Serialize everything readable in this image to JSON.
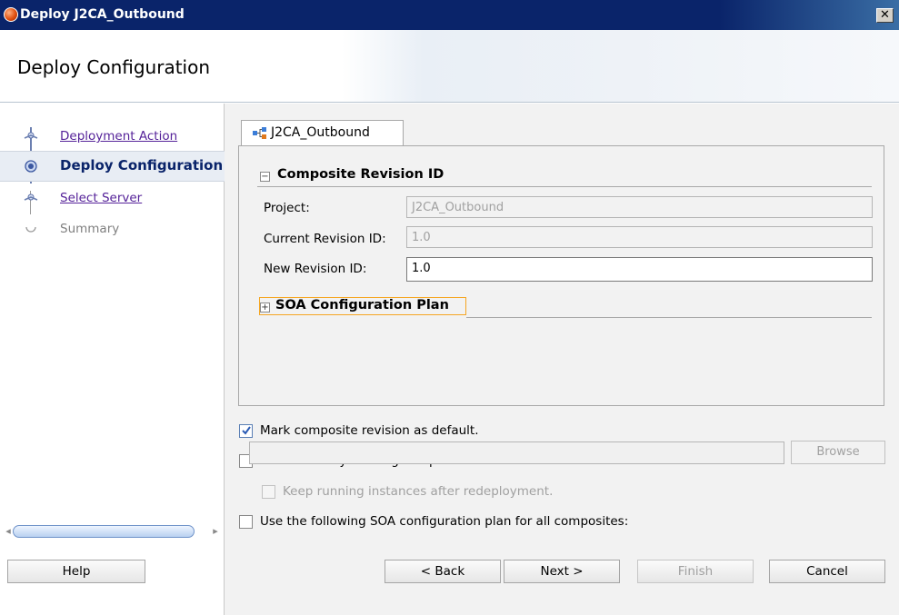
{
  "window": {
    "title": "Deploy J2CA_Outbound",
    "close_symbol": "✕"
  },
  "header": {
    "title": "Deploy Configuration"
  },
  "steps": [
    {
      "label": "Deployment Action",
      "state": "done"
    },
    {
      "label": "Deploy Configuration",
      "state": "current"
    },
    {
      "label": "Select Server",
      "state": "done"
    },
    {
      "label": "Summary",
      "state": "todo"
    }
  ],
  "tab": {
    "label": "J2CA_Outbound"
  },
  "composite_revision": {
    "heading": "Composite Revision ID",
    "toggle": "−",
    "project_label": "Project:",
    "project_value": "J2CA_Outbound",
    "current_label": "Current Revision ID:",
    "current_value": "1.0",
    "new_label": "New Revision ID:",
    "new_value": "1.0"
  },
  "soa_plan": {
    "heading": "SOA Configuration Plan",
    "toggle": "+"
  },
  "options": {
    "mark_default": {
      "label": "Mark composite revision as default.",
      "checked": true
    },
    "overwrite": {
      "label": "Overwrite any existing composites with the same revision ID.",
      "checked": false
    },
    "keep_running": {
      "label": "Keep running instances after redeployment.",
      "checked": false,
      "enabled": false
    },
    "use_plan": {
      "label": "Use the following SOA configuration plan for all composites:",
      "checked": false
    },
    "plan_path": "",
    "browse_label": "Browse"
  },
  "buttons": {
    "help": "Help",
    "back": "< Back",
    "next": "Next >",
    "finish": "Finish",
    "cancel": "Cancel"
  },
  "scrollbar": {
    "left_arrow": "◂",
    "right_arrow": "▸"
  }
}
